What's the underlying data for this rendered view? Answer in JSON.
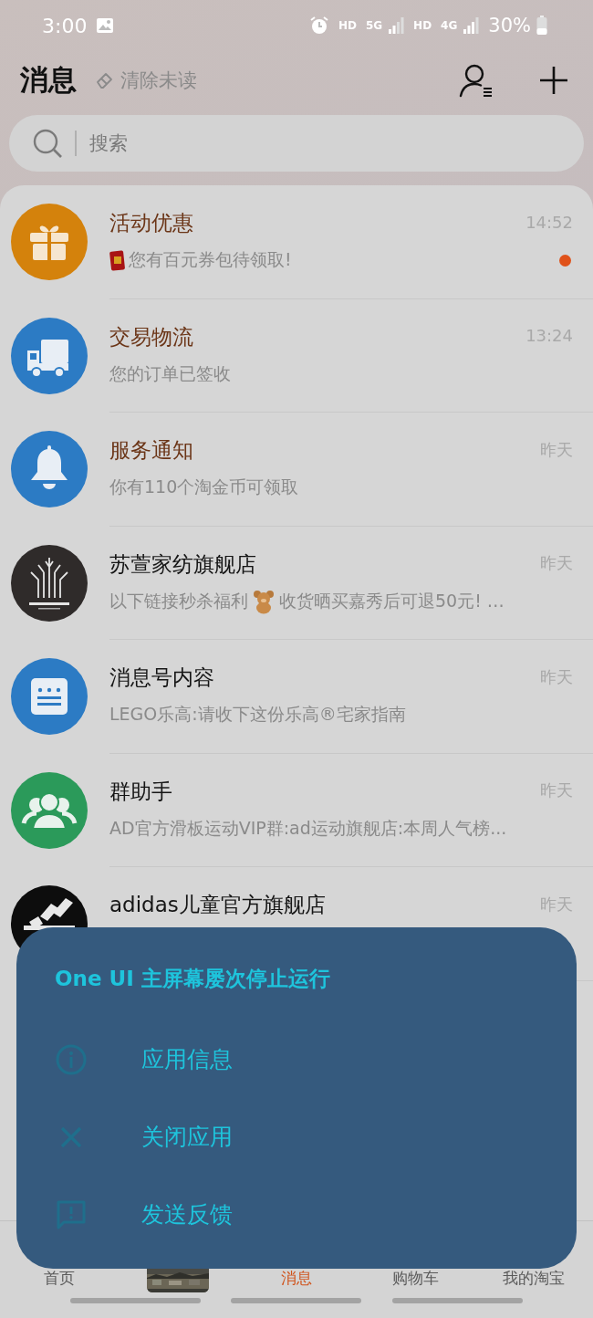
{
  "status_bar": {
    "time": "3:00",
    "network_labels": [
      "HD",
      "5G",
      "HD",
      "4G"
    ],
    "battery": "30%"
  },
  "header": {
    "title": "消息",
    "clear_unread": "清除未读"
  },
  "search": {
    "placeholder": "搜索"
  },
  "conversations": [
    {
      "title": "活动优惠",
      "highlighted": true,
      "time": "14:52",
      "unread": true,
      "subtitle": [
        {
          "kind": "envelope"
        },
        {
          "kind": "text",
          "text": "您有百元券包待领取!"
        }
      ]
    },
    {
      "title": "交易物流",
      "highlighted": true,
      "time": "13:24",
      "unread": false,
      "subtitle": [
        {
          "kind": "text",
          "text": "您的订单已签收"
        }
      ]
    },
    {
      "title": "服务通知",
      "highlighted": true,
      "time": "昨天",
      "unread": false,
      "subtitle": [
        {
          "kind": "text",
          "text": "你有110个淘金币可领取"
        }
      ]
    },
    {
      "title": "苏萱家纺旗舰店",
      "highlighted": false,
      "time": "昨天",
      "unread": false,
      "subtitle": [
        {
          "kind": "text",
          "text": "以下链接秒杀福利"
        },
        {
          "kind": "bear"
        },
        {
          "kind": "text",
          "text": "收货晒买嘉秀后可退50元!  …"
        }
      ]
    },
    {
      "title": "消息号内容",
      "highlighted": false,
      "time": "昨天",
      "unread": false,
      "subtitle": [
        {
          "kind": "text",
          "text": "LEGO乐高:请收下这份乐高®宅家指南"
        }
      ]
    },
    {
      "title": "群助手",
      "highlighted": false,
      "time": "昨天",
      "unread": false,
      "subtitle": [
        {
          "kind": "text",
          "text": "AD官方滑板运动VIP群:ad运动旗舰店:本周人气榜..."
        }
      ]
    },
    {
      "title": "adidas儿童官方旗舰店",
      "highlighted": false,
      "time": "昨天",
      "unread": false
    }
  ],
  "tab_bar": [
    {
      "kind": "label",
      "label": "首页",
      "selected": false
    },
    {
      "kind": "picture",
      "selected": false
    },
    {
      "kind": "label",
      "label": "消息",
      "selected": true
    },
    {
      "kind": "label",
      "label": "购物车",
      "selected": false
    },
    {
      "kind": "label",
      "label": "我的淘宝",
      "selected": false
    }
  ],
  "dialog": {
    "title": "One UI 主屏幕屡次停止运行",
    "actions": [
      {
        "label": "应用信息"
      },
      {
        "label": "关闭应用"
      },
      {
        "label": "发送反馈"
      }
    ]
  }
}
